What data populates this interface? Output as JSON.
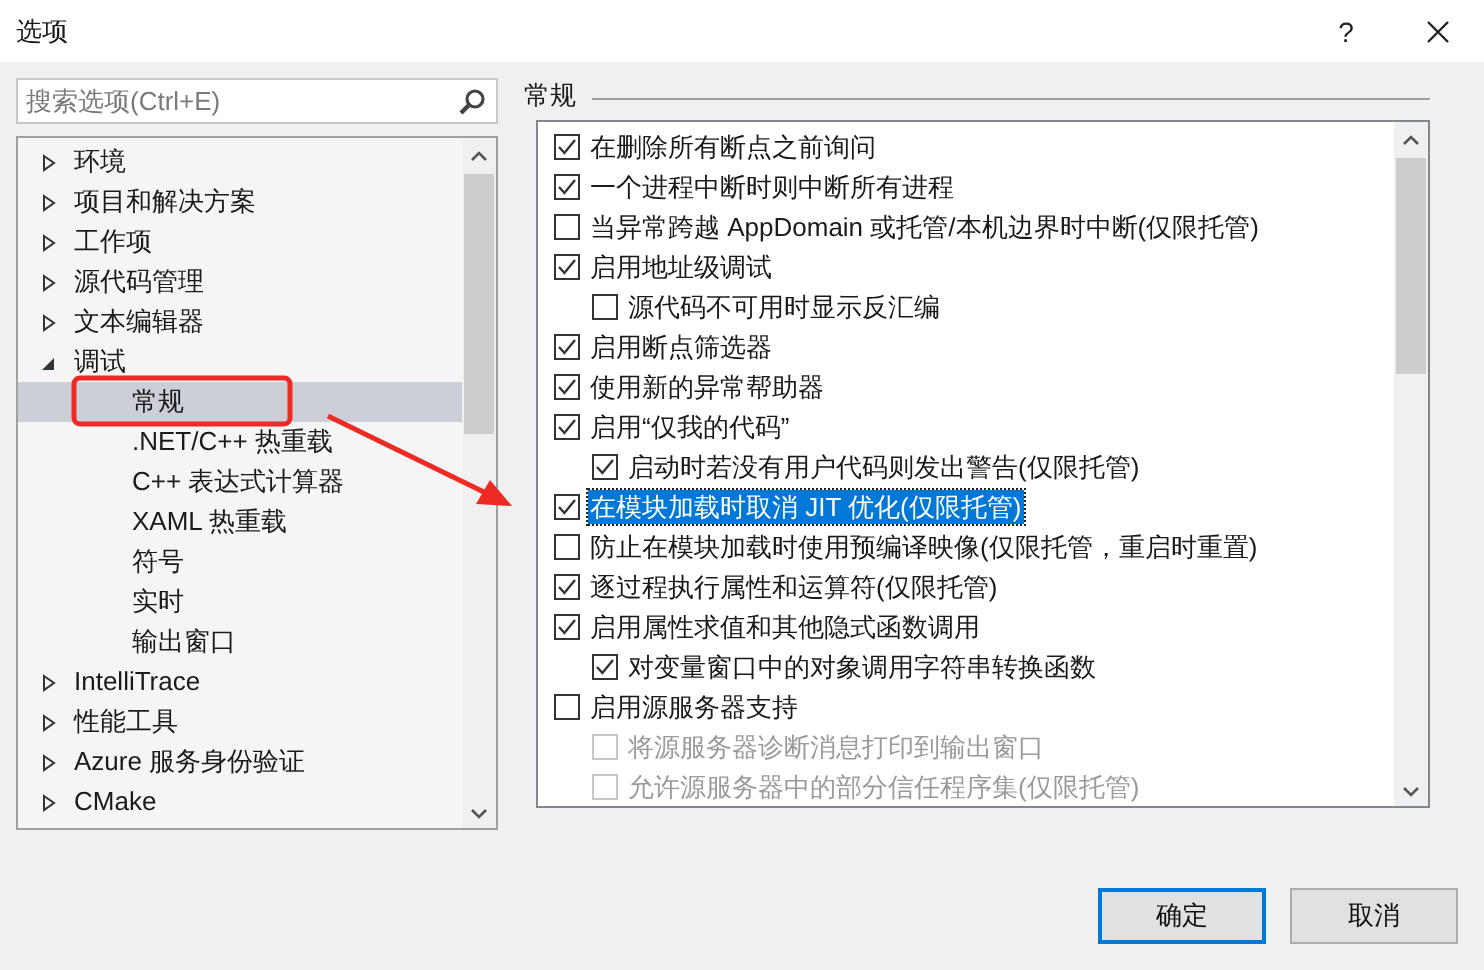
{
  "window": {
    "title": "选项",
    "help": "?"
  },
  "search": {
    "placeholder": "搜索选项(Ctrl+E)"
  },
  "tree": [
    {
      "label": "环境",
      "expanded": false,
      "selected": false
    },
    {
      "label": "项目和解决方案",
      "expanded": false,
      "selected": false
    },
    {
      "label": "工作项",
      "expanded": false,
      "selected": false
    },
    {
      "label": "源代码管理",
      "expanded": false,
      "selected": false
    },
    {
      "label": "文本编辑器",
      "expanded": false,
      "selected": false
    },
    {
      "label": "调试",
      "expanded": true,
      "selected": false,
      "children": [
        {
          "label": "常规",
          "selected": true
        },
        {
          "label": ".NET/C++ 热重载",
          "selected": false
        },
        {
          "label": "C++ 表达式计算器",
          "selected": false
        },
        {
          "label": "XAML 热重载",
          "selected": false
        },
        {
          "label": "符号",
          "selected": false
        },
        {
          "label": "实时",
          "selected": false
        },
        {
          "label": "输出窗口",
          "selected": false
        }
      ]
    },
    {
      "label": "IntelliTrace",
      "expanded": false,
      "selected": false
    },
    {
      "label": "性能工具",
      "expanded": false,
      "selected": false
    },
    {
      "label": "Azure 服务身份验证",
      "expanded": false,
      "selected": false
    },
    {
      "label": "CMake",
      "expanded": false,
      "selected": false
    }
  ],
  "section": {
    "title": "常规"
  },
  "options": [
    {
      "label": "在删除所有断点之前询问",
      "checked": true,
      "selected": false,
      "disabled": false
    },
    {
      "label": "一个进程中断时则中断所有进程",
      "checked": true,
      "selected": false,
      "disabled": false
    },
    {
      "label": "当异常跨越 AppDomain 或托管/本机边界时中断(仅限托管)",
      "checked": false,
      "selected": false,
      "disabled": false
    },
    {
      "label": "启用地址级调试",
      "checked": true,
      "selected": false,
      "disabled": false,
      "children": [
        {
          "label": "源代码不可用时显示反汇编",
          "checked": false,
          "selected": false,
          "disabled": false
        }
      ]
    },
    {
      "label": "启用断点筛选器",
      "checked": true,
      "selected": false,
      "disabled": false
    },
    {
      "label": "使用新的异常帮助器",
      "checked": true,
      "selected": false,
      "disabled": false
    },
    {
      "label": "启用“仅我的代码”",
      "checked": true,
      "selected": false,
      "disabled": false,
      "children": [
        {
          "label": "启动时若没有用户代码则发出警告(仅限托管)",
          "checked": true,
          "selected": false,
          "disabled": false
        }
      ]
    },
    {
      "label": "在模块加载时取消 JIT 优化(仅限托管)",
      "checked": true,
      "selected": true,
      "disabled": false
    },
    {
      "label": "防止在模块加载时使用预编译映像(仅限托管，重启时重置)",
      "checked": false,
      "selected": false,
      "disabled": false
    },
    {
      "label": "逐过程执行属性和运算符(仅限托管)",
      "checked": true,
      "selected": false,
      "disabled": false
    },
    {
      "label": "启用属性求值和其他隐式函数调用",
      "checked": true,
      "selected": false,
      "disabled": false,
      "children": [
        {
          "label": "对变量窗口中的对象调用字符串转换函数",
          "checked": true,
          "selected": false,
          "disabled": false
        }
      ]
    },
    {
      "label": "启用源服务器支持",
      "checked": false,
      "selected": false,
      "disabled": false,
      "children": [
        {
          "label": "将源服务器诊断消息打印到输出窗口",
          "checked": false,
          "selected": false,
          "disabled": true
        },
        {
          "label": "允许源服务器中的部分信任程序集(仅限托管)",
          "checked": false,
          "selected": false,
          "disabled": true
        }
      ]
    }
  ],
  "buttons": [
    {
      "label": "确定",
      "default": true
    },
    {
      "label": "取消",
      "default": false
    }
  ]
}
